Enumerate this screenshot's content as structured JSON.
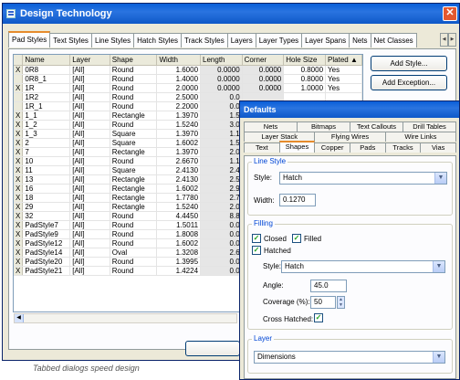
{
  "main": {
    "title": "Design Technology",
    "tabs": [
      "Pad Styles",
      "Text Styles",
      "Line Styles",
      "Hatch Styles",
      "Track Styles",
      "Layers",
      "Layer Types",
      "Layer Spans",
      "Nets",
      "Net Classes"
    ],
    "active_tab": "Pad Styles",
    "buttons": {
      "add_style": "Add Style...",
      "add_exception": "Add Exception..."
    },
    "close_glyph": "✕"
  },
  "grid": {
    "columns": [
      "",
      "Name",
      "Layer",
      "Shape",
      "Width",
      "Length",
      "Corner",
      "Hole Size",
      "Plated ▲"
    ],
    "rows": [
      [
        "X",
        "0R8",
        "[All]",
        "Round",
        "1.6000",
        "0.0000",
        "0.0000",
        "0.8000",
        "Yes"
      ],
      [
        "",
        "0R8_1",
        "[All]",
        "Round",
        "1.4000",
        "0.0000",
        "0.0000",
        "0.8000",
        "Yes"
      ],
      [
        "X",
        "1R",
        "[All]",
        "Round",
        "2.0000",
        "0.0000",
        "0.0000",
        "1.0000",
        "Yes"
      ],
      [
        "",
        "1R2",
        "[All]",
        "Round",
        "2.5000",
        "0.0",
        "",
        "",
        ""
      ],
      [
        "",
        "1R_1",
        "[All]",
        "Round",
        "2.2000",
        "0.0",
        "",
        "",
        ""
      ],
      [
        "X",
        "1_1",
        "[All]",
        "Rectangle",
        "1.3970",
        "1.5",
        "",
        "",
        ""
      ],
      [
        "X",
        "1_2",
        "[All]",
        "Round",
        "1.5240",
        "3.0",
        "",
        "",
        ""
      ],
      [
        "X",
        "1_3",
        "[All]",
        "Square",
        "1.3970",
        "1.1",
        "",
        "",
        ""
      ],
      [
        "X",
        "2",
        "[All]",
        "Square",
        "1.6002",
        "1.5",
        "",
        "",
        ""
      ],
      [
        "X",
        "7",
        "[All]",
        "Rectangle",
        "1.3970",
        "2.0",
        "",
        "",
        ""
      ],
      [
        "X",
        "10",
        "[All]",
        "Round",
        "2.6670",
        "1.1",
        "",
        "",
        ""
      ],
      [
        "X",
        "11",
        "[All]",
        "Square",
        "2.4130",
        "2.4",
        "",
        "",
        ""
      ],
      [
        "X",
        "13",
        "[All]",
        "Rectangle",
        "2.4130",
        "2.5",
        "",
        "",
        ""
      ],
      [
        "X",
        "16",
        "[All]",
        "Rectangle",
        "1.6002",
        "2.9",
        "",
        "",
        ""
      ],
      [
        "X",
        "18",
        "[All]",
        "Rectangle",
        "1.7780",
        "2.7",
        "",
        "",
        ""
      ],
      [
        "X",
        "29",
        "[All]",
        "Rectangle",
        "1.5240",
        "2.0",
        "",
        "",
        ""
      ],
      [
        "X",
        "32",
        "[All]",
        "Round",
        "4.4450",
        "8.8",
        "",
        "",
        ""
      ],
      [
        "X",
        "PadStyle7",
        "[All]",
        "Round",
        "1.5011",
        "0.0",
        "",
        "",
        ""
      ],
      [
        "X",
        "PadStyle9",
        "[All]",
        "Round",
        "1.8008",
        "0.0",
        "",
        "",
        ""
      ],
      [
        "X",
        "PadStyle12",
        "[All]",
        "Round",
        "1.6002",
        "0.0",
        "",
        "",
        ""
      ],
      [
        "X",
        "PadStyle14",
        "[All]",
        "Oval",
        "1.3208",
        "2.6",
        "",
        "",
        ""
      ],
      [
        "X",
        "PadStyle20",
        "[All]",
        "Round",
        "1.3995",
        "0.0",
        "",
        "",
        ""
      ],
      [
        "X",
        "PadStyle21",
        "[All]",
        "Round",
        "1.4224",
        "0.0",
        "",
        "",
        ""
      ]
    ]
  },
  "caption": "Tabbed dialogs speed design",
  "dialog": {
    "title": "Defaults",
    "tab_rows": [
      [
        "Nets",
        "Bitmaps",
        "Text Callouts",
        "Drill Tables"
      ],
      [
        "Layer Stack",
        "Flying Wires",
        "Wire Links"
      ],
      [
        "Text",
        "Shapes",
        "Copper",
        "Pads",
        "Tracks",
        "Vias"
      ]
    ],
    "active_tab": "Shapes",
    "line_style": {
      "group_title": "Line Style",
      "style_label": "Style:",
      "style_value": "Hatch",
      "width_label": "Width:",
      "width_value": "0.1270"
    },
    "filling": {
      "group_title": "Filling",
      "closed_label": "Closed",
      "filled_label": "Filled",
      "hatched_label": "Hatched",
      "closed": true,
      "filled": true,
      "hatched": true,
      "style_label": "Style:",
      "style_value": "Hatch",
      "angle_label": "Angle:",
      "angle_value": "45.0",
      "coverage_label": "Coverage (%):",
      "coverage_value": "50",
      "cross_hatched_label": "Cross Hatched:",
      "cross_hatched": true
    },
    "layer": {
      "group_title": "Layer",
      "value": "Dimensions"
    }
  }
}
